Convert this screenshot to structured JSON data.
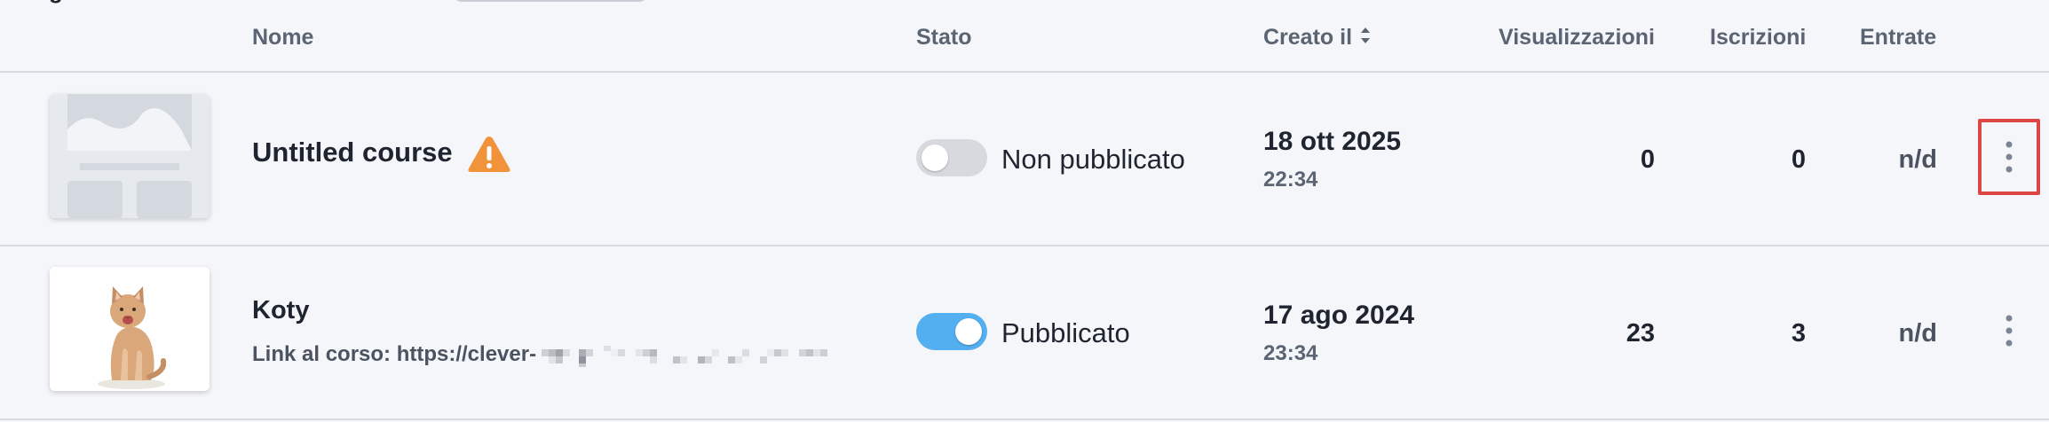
{
  "header": {
    "columns": {
      "name": "Nome",
      "status": "Stato",
      "created": "Creato il",
      "views": "Visualizzazioni",
      "enrollments": "Iscrizioni",
      "revenue": "Entrate"
    }
  },
  "courses": [
    {
      "title": "Untitled course",
      "has_warning": true,
      "status_label": "Non pubblicato",
      "published": false,
      "created_date": "18 ott 2025",
      "created_time": "22:34",
      "views": "0",
      "enrollments": "0",
      "revenue": "n/d",
      "thumbnail": "placeholder-image"
    },
    {
      "title": "Koty",
      "link_text": "Link al corso: https://clever-",
      "status_label": "Pubblicato",
      "published": true,
      "created_date": "17 ago 2024",
      "created_time": "23:34",
      "views": "23",
      "enrollments": "3",
      "revenue": "n/d",
      "thumbnail": "cat-photo"
    }
  ],
  "colors": {
    "toggle_on": "#53aff0",
    "toggle_off": "#d7d9de",
    "warning": "#f0933b",
    "highlight": "#de4646"
  }
}
